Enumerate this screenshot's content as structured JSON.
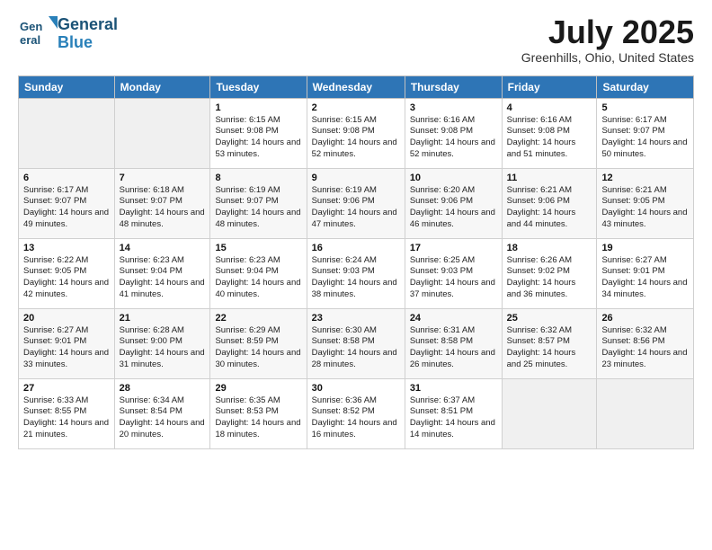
{
  "header": {
    "logo_line1": "General",
    "logo_line2": "Blue",
    "month": "July 2025",
    "location": "Greenhills, Ohio, United States"
  },
  "weekdays": [
    "Sunday",
    "Monday",
    "Tuesday",
    "Wednesday",
    "Thursday",
    "Friday",
    "Saturday"
  ],
  "weeks": [
    [
      {
        "day": "",
        "sunrise": "",
        "sunset": "",
        "daylight": ""
      },
      {
        "day": "",
        "sunrise": "",
        "sunset": "",
        "daylight": ""
      },
      {
        "day": "1",
        "sunrise": "Sunrise: 6:15 AM",
        "sunset": "Sunset: 9:08 PM",
        "daylight": "Daylight: 14 hours and 53 minutes."
      },
      {
        "day": "2",
        "sunrise": "Sunrise: 6:15 AM",
        "sunset": "Sunset: 9:08 PM",
        "daylight": "Daylight: 14 hours and 52 minutes."
      },
      {
        "day": "3",
        "sunrise": "Sunrise: 6:16 AM",
        "sunset": "Sunset: 9:08 PM",
        "daylight": "Daylight: 14 hours and 52 minutes."
      },
      {
        "day": "4",
        "sunrise": "Sunrise: 6:16 AM",
        "sunset": "Sunset: 9:08 PM",
        "daylight": "Daylight: 14 hours and 51 minutes."
      },
      {
        "day": "5",
        "sunrise": "Sunrise: 6:17 AM",
        "sunset": "Sunset: 9:07 PM",
        "daylight": "Daylight: 14 hours and 50 minutes."
      }
    ],
    [
      {
        "day": "6",
        "sunrise": "Sunrise: 6:17 AM",
        "sunset": "Sunset: 9:07 PM",
        "daylight": "Daylight: 14 hours and 49 minutes."
      },
      {
        "day": "7",
        "sunrise": "Sunrise: 6:18 AM",
        "sunset": "Sunset: 9:07 PM",
        "daylight": "Daylight: 14 hours and 48 minutes."
      },
      {
        "day": "8",
        "sunrise": "Sunrise: 6:19 AM",
        "sunset": "Sunset: 9:07 PM",
        "daylight": "Daylight: 14 hours and 48 minutes."
      },
      {
        "day": "9",
        "sunrise": "Sunrise: 6:19 AM",
        "sunset": "Sunset: 9:06 PM",
        "daylight": "Daylight: 14 hours and 47 minutes."
      },
      {
        "day": "10",
        "sunrise": "Sunrise: 6:20 AM",
        "sunset": "Sunset: 9:06 PM",
        "daylight": "Daylight: 14 hours and 46 minutes."
      },
      {
        "day": "11",
        "sunrise": "Sunrise: 6:21 AM",
        "sunset": "Sunset: 9:06 PM",
        "daylight": "Daylight: 14 hours and 44 minutes."
      },
      {
        "day": "12",
        "sunrise": "Sunrise: 6:21 AM",
        "sunset": "Sunset: 9:05 PM",
        "daylight": "Daylight: 14 hours and 43 minutes."
      }
    ],
    [
      {
        "day": "13",
        "sunrise": "Sunrise: 6:22 AM",
        "sunset": "Sunset: 9:05 PM",
        "daylight": "Daylight: 14 hours and 42 minutes."
      },
      {
        "day": "14",
        "sunrise": "Sunrise: 6:23 AM",
        "sunset": "Sunset: 9:04 PM",
        "daylight": "Daylight: 14 hours and 41 minutes."
      },
      {
        "day": "15",
        "sunrise": "Sunrise: 6:23 AM",
        "sunset": "Sunset: 9:04 PM",
        "daylight": "Daylight: 14 hours and 40 minutes."
      },
      {
        "day": "16",
        "sunrise": "Sunrise: 6:24 AM",
        "sunset": "Sunset: 9:03 PM",
        "daylight": "Daylight: 14 hours and 38 minutes."
      },
      {
        "day": "17",
        "sunrise": "Sunrise: 6:25 AM",
        "sunset": "Sunset: 9:03 PM",
        "daylight": "Daylight: 14 hours and 37 minutes."
      },
      {
        "day": "18",
        "sunrise": "Sunrise: 6:26 AM",
        "sunset": "Sunset: 9:02 PM",
        "daylight": "Daylight: 14 hours and 36 minutes."
      },
      {
        "day": "19",
        "sunrise": "Sunrise: 6:27 AM",
        "sunset": "Sunset: 9:01 PM",
        "daylight": "Daylight: 14 hours and 34 minutes."
      }
    ],
    [
      {
        "day": "20",
        "sunrise": "Sunrise: 6:27 AM",
        "sunset": "Sunset: 9:01 PM",
        "daylight": "Daylight: 14 hours and 33 minutes."
      },
      {
        "day": "21",
        "sunrise": "Sunrise: 6:28 AM",
        "sunset": "Sunset: 9:00 PM",
        "daylight": "Daylight: 14 hours and 31 minutes."
      },
      {
        "day": "22",
        "sunrise": "Sunrise: 6:29 AM",
        "sunset": "Sunset: 8:59 PM",
        "daylight": "Daylight: 14 hours and 30 minutes."
      },
      {
        "day": "23",
        "sunrise": "Sunrise: 6:30 AM",
        "sunset": "Sunset: 8:58 PM",
        "daylight": "Daylight: 14 hours and 28 minutes."
      },
      {
        "day": "24",
        "sunrise": "Sunrise: 6:31 AM",
        "sunset": "Sunset: 8:58 PM",
        "daylight": "Daylight: 14 hours and 26 minutes."
      },
      {
        "day": "25",
        "sunrise": "Sunrise: 6:32 AM",
        "sunset": "Sunset: 8:57 PM",
        "daylight": "Daylight: 14 hours and 25 minutes."
      },
      {
        "day": "26",
        "sunrise": "Sunrise: 6:32 AM",
        "sunset": "Sunset: 8:56 PM",
        "daylight": "Daylight: 14 hours and 23 minutes."
      }
    ],
    [
      {
        "day": "27",
        "sunrise": "Sunrise: 6:33 AM",
        "sunset": "Sunset: 8:55 PM",
        "daylight": "Daylight: 14 hours and 21 minutes."
      },
      {
        "day": "28",
        "sunrise": "Sunrise: 6:34 AM",
        "sunset": "Sunset: 8:54 PM",
        "daylight": "Daylight: 14 hours and 20 minutes."
      },
      {
        "day": "29",
        "sunrise": "Sunrise: 6:35 AM",
        "sunset": "Sunset: 8:53 PM",
        "daylight": "Daylight: 14 hours and 18 minutes."
      },
      {
        "day": "30",
        "sunrise": "Sunrise: 6:36 AM",
        "sunset": "Sunset: 8:52 PM",
        "daylight": "Daylight: 14 hours and 16 minutes."
      },
      {
        "day": "31",
        "sunrise": "Sunrise: 6:37 AM",
        "sunset": "Sunset: 8:51 PM",
        "daylight": "Daylight: 14 hours and 14 minutes."
      },
      {
        "day": "",
        "sunrise": "",
        "sunset": "",
        "daylight": ""
      },
      {
        "day": "",
        "sunrise": "",
        "sunset": "",
        "daylight": ""
      }
    ]
  ]
}
